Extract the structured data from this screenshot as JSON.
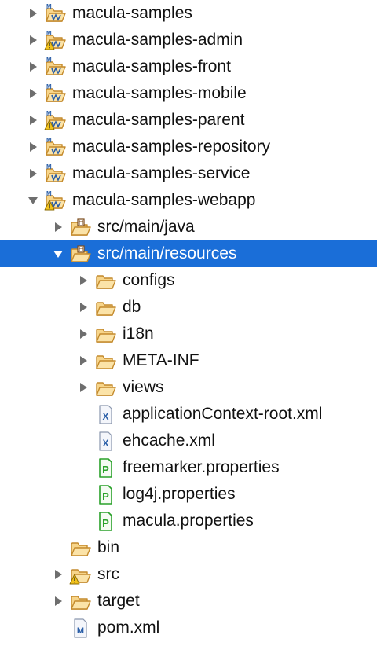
{
  "tree": {
    "nodes": [
      {
        "name": "macula-samples",
        "depth": 0,
        "expander": "collapsed",
        "icon": "maven-project-icon",
        "badge": "none"
      },
      {
        "name": "macula-samples-admin",
        "depth": 0,
        "expander": "collapsed",
        "icon": "maven-project-icon",
        "badge": "warning"
      },
      {
        "name": "macula-samples-front",
        "depth": 0,
        "expander": "collapsed",
        "icon": "maven-project-icon",
        "badge": "none"
      },
      {
        "name": "macula-samples-mobile",
        "depth": 0,
        "expander": "collapsed",
        "icon": "maven-project-icon",
        "badge": "none"
      },
      {
        "name": "macula-samples-parent",
        "depth": 0,
        "expander": "collapsed",
        "icon": "maven-project-icon",
        "badge": "warning"
      },
      {
        "name": "macula-samples-repository",
        "depth": 0,
        "expander": "collapsed",
        "icon": "maven-project-icon",
        "badge": "none"
      },
      {
        "name": "macula-samples-service",
        "depth": 0,
        "expander": "collapsed",
        "icon": "maven-project-icon",
        "badge": "none"
      },
      {
        "name": "macula-samples-webapp",
        "depth": 0,
        "expander": "expanded",
        "icon": "maven-project-icon",
        "badge": "warning"
      },
      {
        "name": "src/main/java",
        "depth": 1,
        "expander": "collapsed",
        "icon": "source-folder-icon",
        "badge": "none"
      },
      {
        "name": "src/main/resources",
        "depth": 1,
        "expander": "expanded",
        "icon": "source-folder-icon",
        "badge": "none",
        "selected": true
      },
      {
        "name": "configs",
        "depth": 2,
        "expander": "collapsed",
        "icon": "folder-icon",
        "badge": "none"
      },
      {
        "name": "db",
        "depth": 2,
        "expander": "collapsed",
        "icon": "folder-icon",
        "badge": "none"
      },
      {
        "name": "i18n",
        "depth": 2,
        "expander": "collapsed",
        "icon": "folder-icon",
        "badge": "none"
      },
      {
        "name": "META-INF",
        "depth": 2,
        "expander": "collapsed",
        "icon": "folder-icon",
        "badge": "none"
      },
      {
        "name": "views",
        "depth": 2,
        "expander": "collapsed",
        "icon": "folder-icon",
        "badge": "none"
      },
      {
        "name": "applicationContext-root.xml",
        "depth": 2,
        "expander": "none",
        "icon": "xml-file-icon",
        "badge": "none"
      },
      {
        "name": "ehcache.xml",
        "depth": 2,
        "expander": "none",
        "icon": "xml-file-icon",
        "badge": "none"
      },
      {
        "name": "freemarker.properties",
        "depth": 2,
        "expander": "none",
        "icon": "properties-file-icon",
        "badge": "none"
      },
      {
        "name": "log4j.properties",
        "depth": 2,
        "expander": "none",
        "icon": "properties-file-icon",
        "badge": "none"
      },
      {
        "name": "macula.properties",
        "depth": 2,
        "expander": "none",
        "icon": "properties-file-icon",
        "badge": "none"
      },
      {
        "name": "bin",
        "depth": 1,
        "expander": "none",
        "icon": "folder-icon",
        "badge": "none"
      },
      {
        "name": "src",
        "depth": 1,
        "expander": "collapsed",
        "icon": "folder-icon",
        "badge": "warning"
      },
      {
        "name": "target",
        "depth": 1,
        "expander": "collapsed",
        "icon": "folder-icon",
        "badge": "none"
      },
      {
        "name": "pom.xml",
        "depth": 1,
        "expander": "none",
        "icon": "maven-pom-icon",
        "badge": "none"
      }
    ]
  },
  "colors": {
    "selection": "#1a6ed8",
    "folder_fill": "#f7d58a",
    "folder_stroke": "#c48a2c",
    "project_blue": "#2b5fa8",
    "warning": "#f2c21b",
    "xml_blue": "#2b5fa8",
    "properties_green": "#2aa12a"
  }
}
